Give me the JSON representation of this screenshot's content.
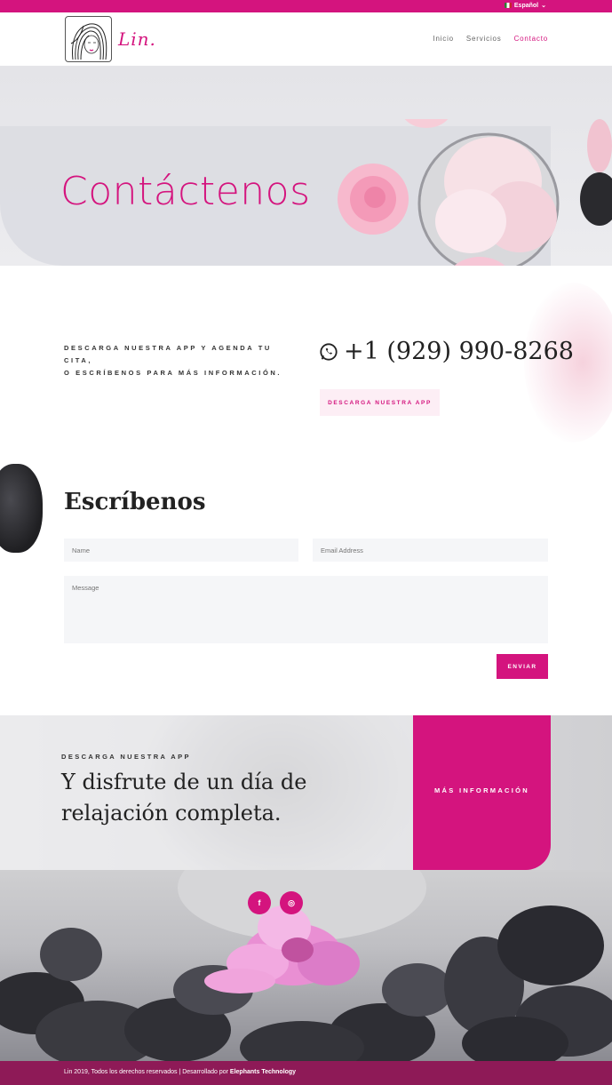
{
  "topbar": {
    "language": "Español"
  },
  "header": {
    "logo_text": "Lin.",
    "nav": [
      {
        "label": "Inicio"
      },
      {
        "label": "Servicios"
      },
      {
        "label": "Contacto"
      }
    ]
  },
  "hero": {
    "title": "Contáctenos"
  },
  "contact": {
    "text_line1": "DESCARGA NUESTRA APP Y AGENDA TU CITA,",
    "text_line2": "O ESCRÍBENOS PARA MÁS INFORMACIÓN.",
    "phone": "+1 (929) 990-8268",
    "app_button": "DESCARGA NUESTRA APP"
  },
  "form": {
    "title": "Escríbenos",
    "name_placeholder": "Name",
    "email_placeholder": "Email Address",
    "message_placeholder": "Message",
    "submit_label": "ENVIAR"
  },
  "promo": {
    "subtitle": "DESCARGA NUESTRA APP",
    "title": "Y disfrute de un día de relajación completa.",
    "button": "MÁS INFORMACIÓN"
  },
  "social": {
    "facebook": "f",
    "instagram": "◎"
  },
  "footer": {
    "text": "Lin 2019, Todos los derechos reservados | Desarrollado por",
    "company": "Elephants Technology"
  },
  "colors": {
    "accent": "#d4147e",
    "footer": "#8e1a57"
  }
}
